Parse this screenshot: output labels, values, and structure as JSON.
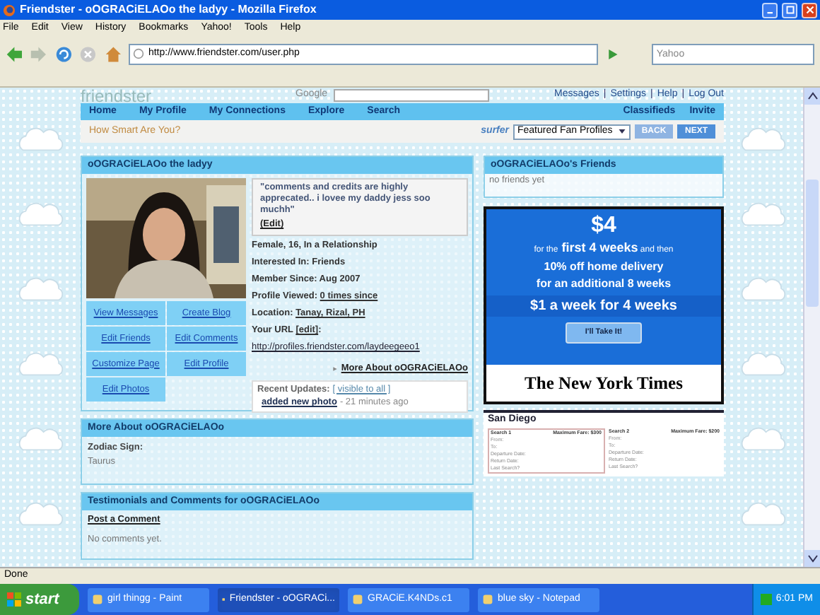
{
  "window": {
    "title": "Friendster - oOGRACiELAOo the ladyy - Mozilla Firefox"
  },
  "menu": [
    "File",
    "Edit",
    "View",
    "History",
    "Bookmarks",
    "Yahoo!",
    "Tools",
    "Help"
  ],
  "toolbar": {
    "url": "http://www.friendster.com/user.php",
    "search_placeholder": "Yahoo"
  },
  "header": {
    "logo": "friendster",
    "google": "Google",
    "links": [
      "Messages",
      "Settings",
      "Help",
      "Log Out"
    ],
    "separator": "|"
  },
  "nav": {
    "left": [
      "Home",
      "My Profile",
      "My Connections",
      "Explore",
      "Search"
    ],
    "right": [
      "Classifieds",
      "Invite"
    ]
  },
  "promo": {
    "text": "How Smart Are You?",
    "surfer": "surfer",
    "select": "Featured Fan Profiles",
    "buttons": [
      "BACK",
      "NEXT"
    ]
  },
  "profile": {
    "title": "oOGRACiELAOo the ladyy",
    "quote": "\"comments and credits are highly apprecated.. i lovee my daddy jess soo muchh\"",
    "edit": "(Edit)",
    "actions": [
      "View Messages",
      "Create Blog",
      "Edit Friends",
      "Edit Comments",
      "Customize Page",
      "Edit Profile",
      "Edit Photos"
    ],
    "details": [
      {
        "label": "Female, 16, In a Relationship"
      },
      {
        "label": "Interested In: Friends"
      },
      {
        "label": "Member Since: Aug 2007"
      },
      {
        "label": "Profile Viewed: ",
        "link": "0 times since"
      },
      {
        "label": "Location: ",
        "link": "Tanay, Rizal, PH"
      },
      {
        "label": "Your URL ",
        "link": "[edit]",
        "suffix": ":"
      }
    ],
    "url": "http://profiles.friendster.com/laydeegeeo1",
    "more_link": "More About oOGRACiELAOo",
    "updates": {
      "label": "Recent Updates:",
      "visibility": "[ visible to all ]",
      "item": "added new photo",
      "time": "- 21 minutes ago"
    }
  },
  "friends": {
    "title": "oOGRACiELAOo's Friends",
    "empty": "no friends yet"
  },
  "ad_nyt": {
    "price": "$4",
    "line1": [
      "for the",
      "first 4 weeks",
      "and then"
    ],
    "line2": "10% off home delivery",
    "line3": "for an additional 8 weeks",
    "line4": "$1 a week for 4 weeks",
    "button": "I'll Take It!",
    "logo": "The New York Times"
  },
  "ad_travel": {
    "title": "San Diego",
    "columns": [
      {
        "head": "Search 1",
        "fare": "Maximum Fare: $300",
        "rows": [
          "From:",
          "To:",
          "Departure Date:",
          "Return Date:",
          "Last Search?"
        ]
      },
      {
        "head": "Search 2",
        "fare": "Maximum Fare: $200",
        "rows": [
          "From:",
          "To:",
          "Departure Date:",
          "Return Date:",
          "Last Search?"
        ]
      }
    ]
  },
  "more_about": {
    "title": "More About oOGRACiELAOo",
    "label": "Zodiac Sign:",
    "value": "Taurus"
  },
  "testimonials": {
    "title": "Testimonials and Comments for oOGRACiELAOo",
    "post": "Post a Comment",
    "empty": "No comments yet."
  },
  "status": "Done",
  "taskbar": {
    "start": "start",
    "tasks": [
      {
        "label": "girl thingg - Paint",
        "selected": false
      },
      {
        "label": "Friendster - oOGRACi...",
        "selected": true
      },
      {
        "label": "GRACiE.K4NDs.c1",
        "selected": false
      },
      {
        "label": "blue sky - Notepad",
        "selected": false
      }
    ],
    "clock": "6:01 PM"
  }
}
